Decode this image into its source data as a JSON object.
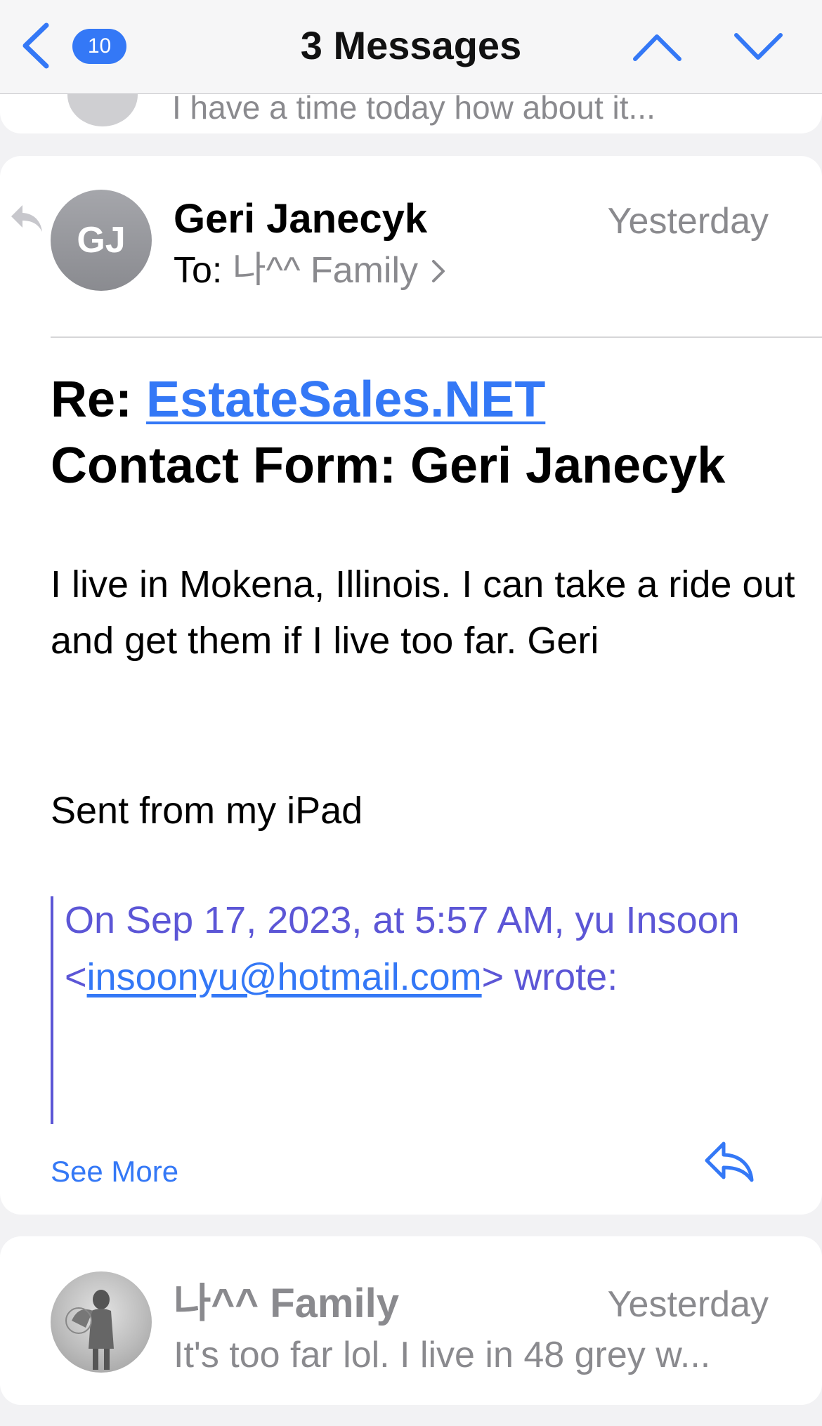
{
  "nav": {
    "unread_badge": "10",
    "title": "3 Messages"
  },
  "previous_message": {
    "snippet": "I have a time today how about it..."
  },
  "message": {
    "avatar_initials": "GJ",
    "sender": "Geri Janecyk",
    "date": "Yesterday",
    "to_label": "To:",
    "to_recipient": "나^^ Family",
    "subject_prefix": "Re:",
    "subject_link": "EstateSales.NET",
    "subject_rest": "Contact Form: Geri Janecyk",
    "body": "I live in Mokena, Illinois. I can take a ride out and get them if I live too far. Geri",
    "signature": "Sent from my iPad",
    "quote_intro": "On Sep 17, 2023, at 5:57 AM, yu Insoon <",
    "quote_email": "insoonyu@hotmail.com",
    "quote_outro": "> wrote:",
    "see_more": "See More"
  },
  "next_message": {
    "sender": "나^^ Family",
    "date": "Yesterday",
    "snippet": "It's too far lol. I live in 48 grey w..."
  },
  "colors": {
    "accent": "#3478f6",
    "quote": "#5c56d6",
    "secondary_text": "#8a8a8e"
  }
}
